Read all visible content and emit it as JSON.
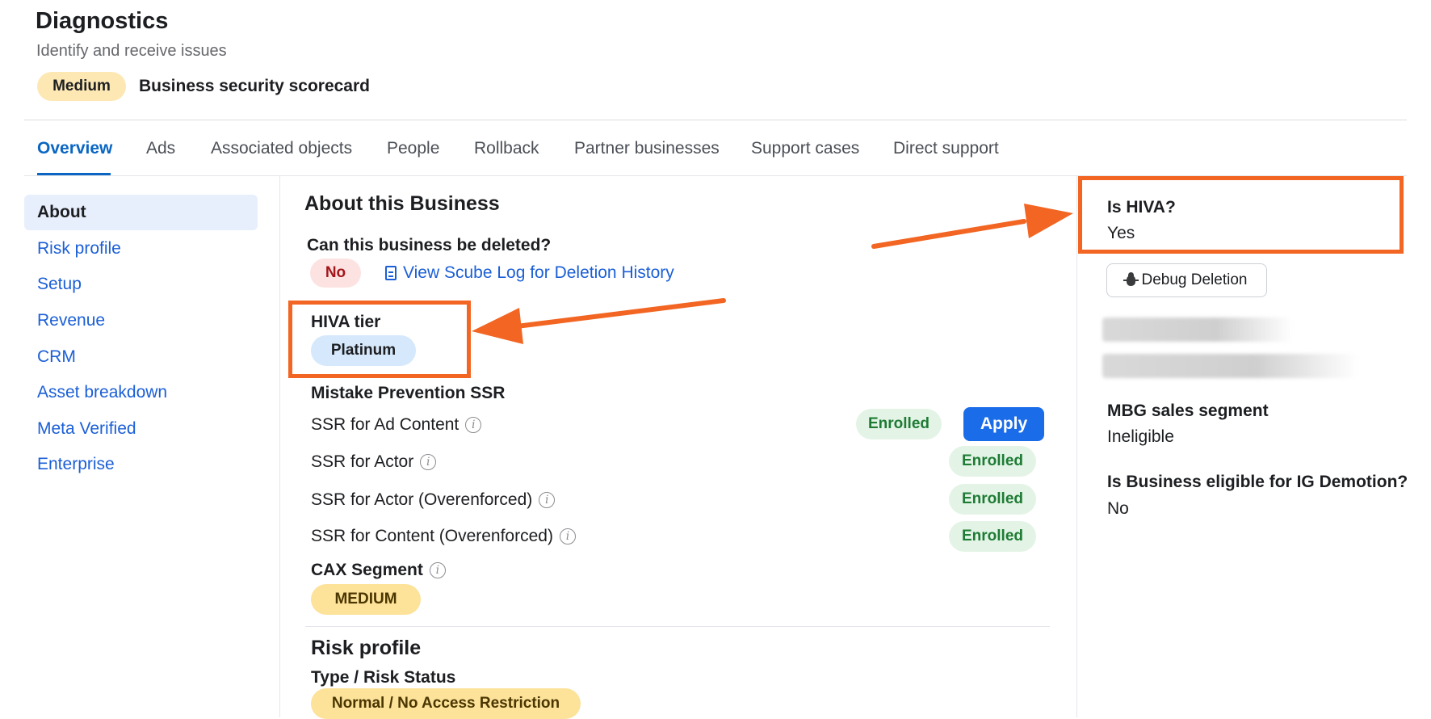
{
  "header": {
    "title": "Diagnostics",
    "subtitle": "Identify and receive issues",
    "severity_badge": "Medium",
    "scorecard_label": "Business security scorecard"
  },
  "tabs": [
    "Overview",
    "Ads",
    "Associated objects",
    "People",
    "Rollback",
    "Partner businesses",
    "Support cases",
    "Direct support"
  ],
  "active_tab": "Overview",
  "sidebar": {
    "items": [
      "About",
      "Risk profile",
      "Setup",
      "Revenue",
      "CRM",
      "Asset breakdown",
      "Meta Verified",
      "Enterprise"
    ],
    "active": "About"
  },
  "main": {
    "section_title": "About this Business",
    "deletable_label": "Can this business be deleted?",
    "deletable_value": "No",
    "deletion_link": "View Scube Log for Deletion History",
    "hiva_tier_label": "HIVA tier",
    "hiva_tier_value": "Platinum",
    "mistake_prevention_label": "Mistake Prevention SSR",
    "ssr_rows": [
      {
        "label": "SSR for Ad Content",
        "status": "Enrolled",
        "action": "Apply"
      },
      {
        "label": "SSR for Actor",
        "status": "Enrolled"
      },
      {
        "label": "SSR for Actor (Overenforced)",
        "status": "Enrolled"
      },
      {
        "label": "SSR for Content (Overenforced)",
        "status": "Enrolled"
      }
    ],
    "cax_segment_label": "CAX Segment",
    "cax_segment_value": "MEDIUM",
    "risk_profile_title": "Risk profile",
    "risk_status_label": "Type / Risk Status",
    "risk_status_value": "Normal / No Access Restriction"
  },
  "right_panel": {
    "is_hiva_label": "Is HIVA?",
    "is_hiva_value": "Yes",
    "debug_button": "Debug Deletion",
    "mbg_label": "MBG sales segment",
    "mbg_value": "Ineligible",
    "ig_demotion_label": "Is Business eligible for IG Demotion?",
    "ig_demotion_value": "No"
  },
  "annotations": {
    "color": "#f26522",
    "highlighted_fields": [
      "HIVA tier",
      "Is HIVA?"
    ]
  },
  "colors": {
    "link_blue": "#1b5fd6",
    "primary_button": "#1a6ce8",
    "enrolled_bg": "#e3f4e6",
    "enrolled_text": "#1e7b34",
    "medium_bg": "#fde29a",
    "no_bg": "#fde2e2"
  },
  "icons": [
    "info-icon",
    "document-icon",
    "bug-icon"
  ]
}
